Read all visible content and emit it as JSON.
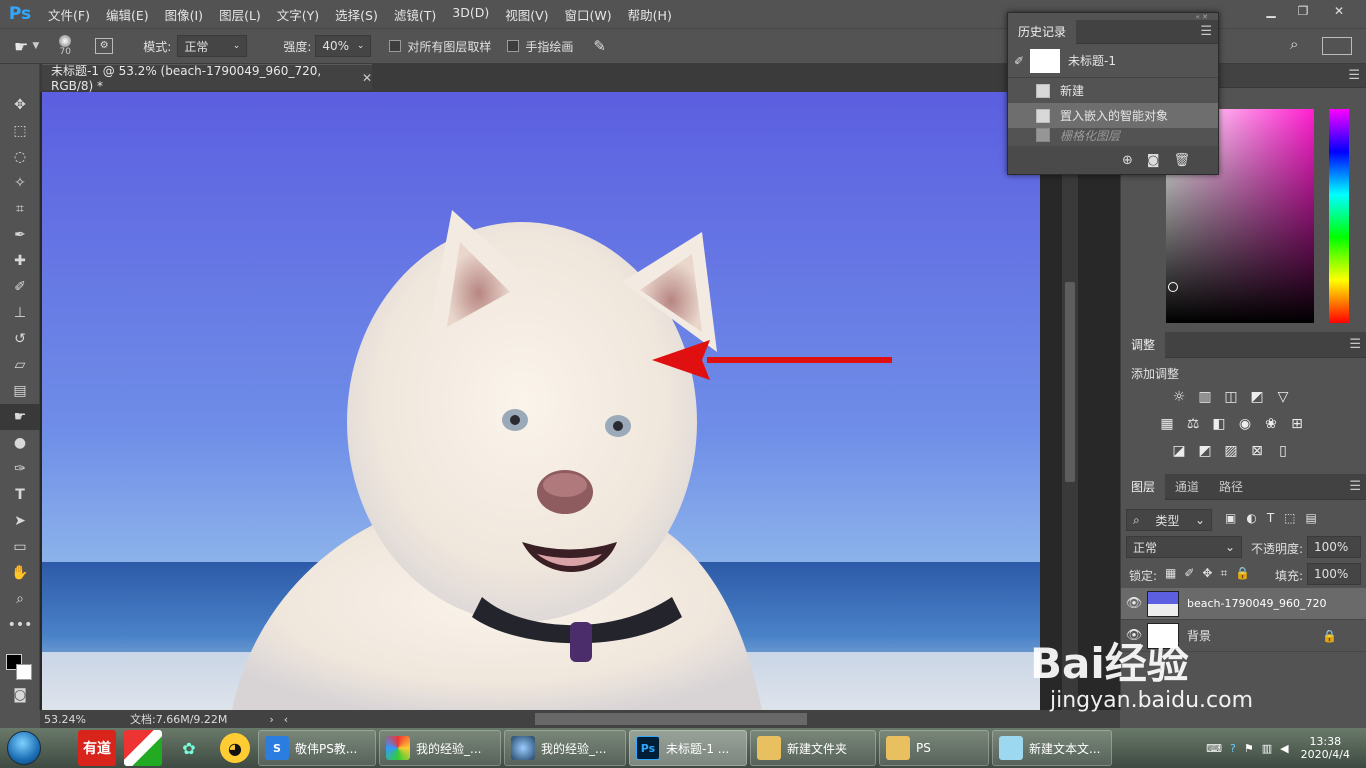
{
  "app": {
    "logo": "Ps",
    "menus": [
      "文件(F)",
      "编辑(E)",
      "图像(I)",
      "图层(L)",
      "文字(Y)",
      "选择(S)",
      "滤镜(T)",
      "3D(D)",
      "视图(V)",
      "窗口(W)",
      "帮助(H)"
    ]
  },
  "options": {
    "brush_size": "70",
    "mode_label": "模式:",
    "mode_value": "正常",
    "strength_label": "强度:",
    "strength_value": "40%",
    "sample_all_label": "对所有图层取样",
    "finger_paint_label": "手指绘画"
  },
  "document": {
    "tab_title": "未标题-1 @ 53.2% (beach-1790049_960_720, RGB/8) *",
    "zoom": "53.24%",
    "doc_size": "文档:7.66M/9.22M"
  },
  "history": {
    "title": "历史记录",
    "snapshot": "未标题-1",
    "items": [
      "新建",
      "置入嵌入的智能对象",
      "栅格化图层"
    ]
  },
  "adjustments": {
    "title": "调整",
    "subtitle": "添加调整"
  },
  "layers": {
    "tabs": [
      "图层",
      "通道",
      "路径"
    ],
    "filter_label": "类型",
    "blend_mode": "正常",
    "opacity_label": "不透明度:",
    "opacity_value": "100%",
    "lock_label": "锁定:",
    "fill_label": "填充:",
    "fill_value": "100%",
    "items": [
      {
        "name": "beach-1790049_960_720"
      },
      {
        "name": "背景"
      }
    ]
  },
  "taskbar": {
    "buttons": [
      "敬伟PS教...",
      "我的经验_...",
      "我的经验_...",
      "未标题-1 ...",
      "新建文件夹",
      "PS",
      "新建文本文..."
    ],
    "time": "13:38",
    "date": "2020/4/4"
  },
  "watermark": {
    "brand": "Bai经验",
    "url": "jingyan.baidu.com"
  },
  "colors": {
    "ps_blue": "#31a8ff",
    "arrow_red": "#e01010",
    "panel_bg": "#535353"
  }
}
